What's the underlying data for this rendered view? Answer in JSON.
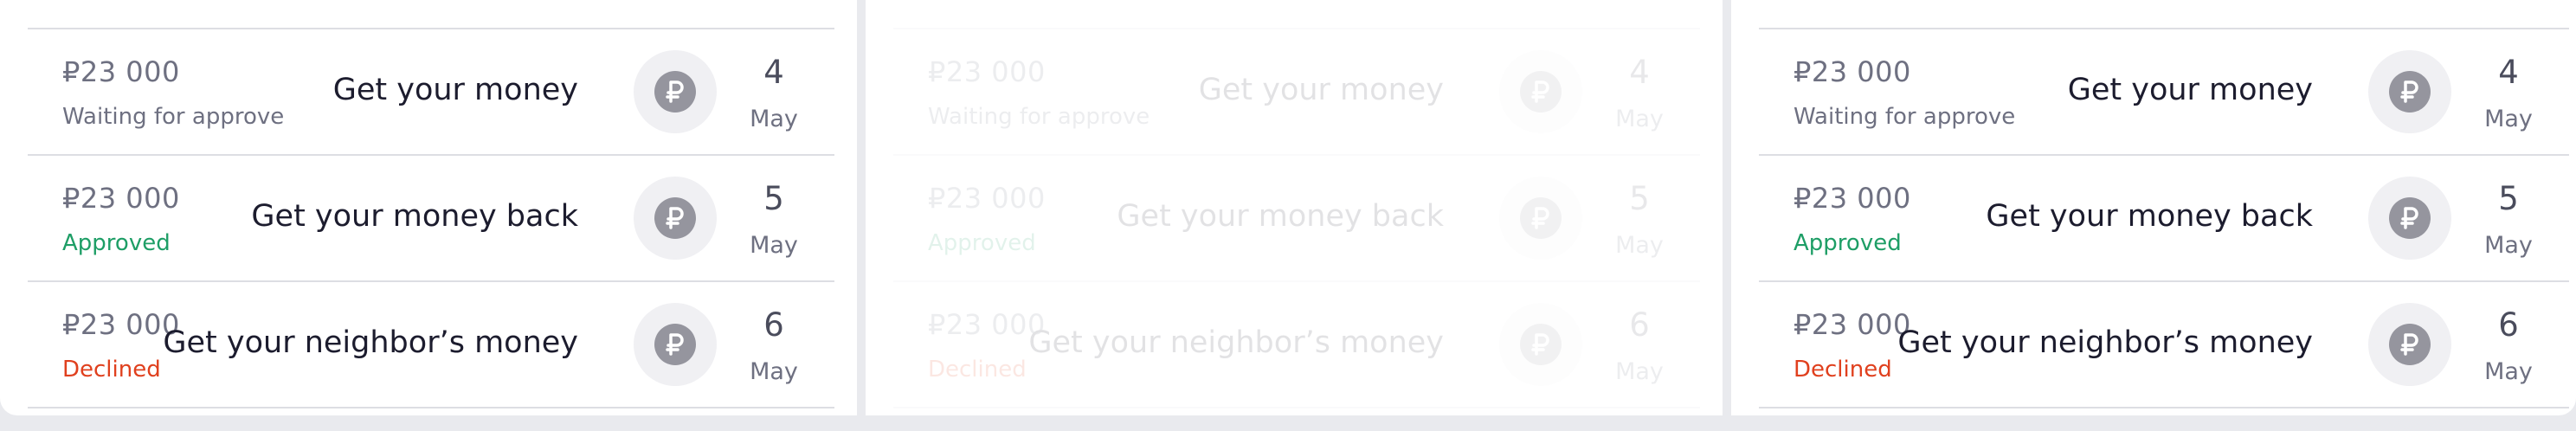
{
  "transactions": [
    {
      "amount": "₽23 000",
      "status": "Waiting for approve",
      "title": "Get your money",
      "day": "4",
      "month": "May",
      "status_color": "#6e7081"
    },
    {
      "amount": "₽23 000",
      "status": "Approved",
      "title": "Get your money back",
      "day": "5",
      "month": "May",
      "status_color": "#1e9e66"
    },
    {
      "amount": "₽23 000",
      "status": "Declined",
      "title": "Get your neighbor’s money",
      "day": "6",
      "month": "May",
      "status_color": "#e0401e"
    }
  ],
  "icons": {
    "transaction": "ruble-coin-icon"
  },
  "colors": {
    "approved": "#1e9e66",
    "declined": "#e0401e",
    "coin": "#95959e"
  }
}
